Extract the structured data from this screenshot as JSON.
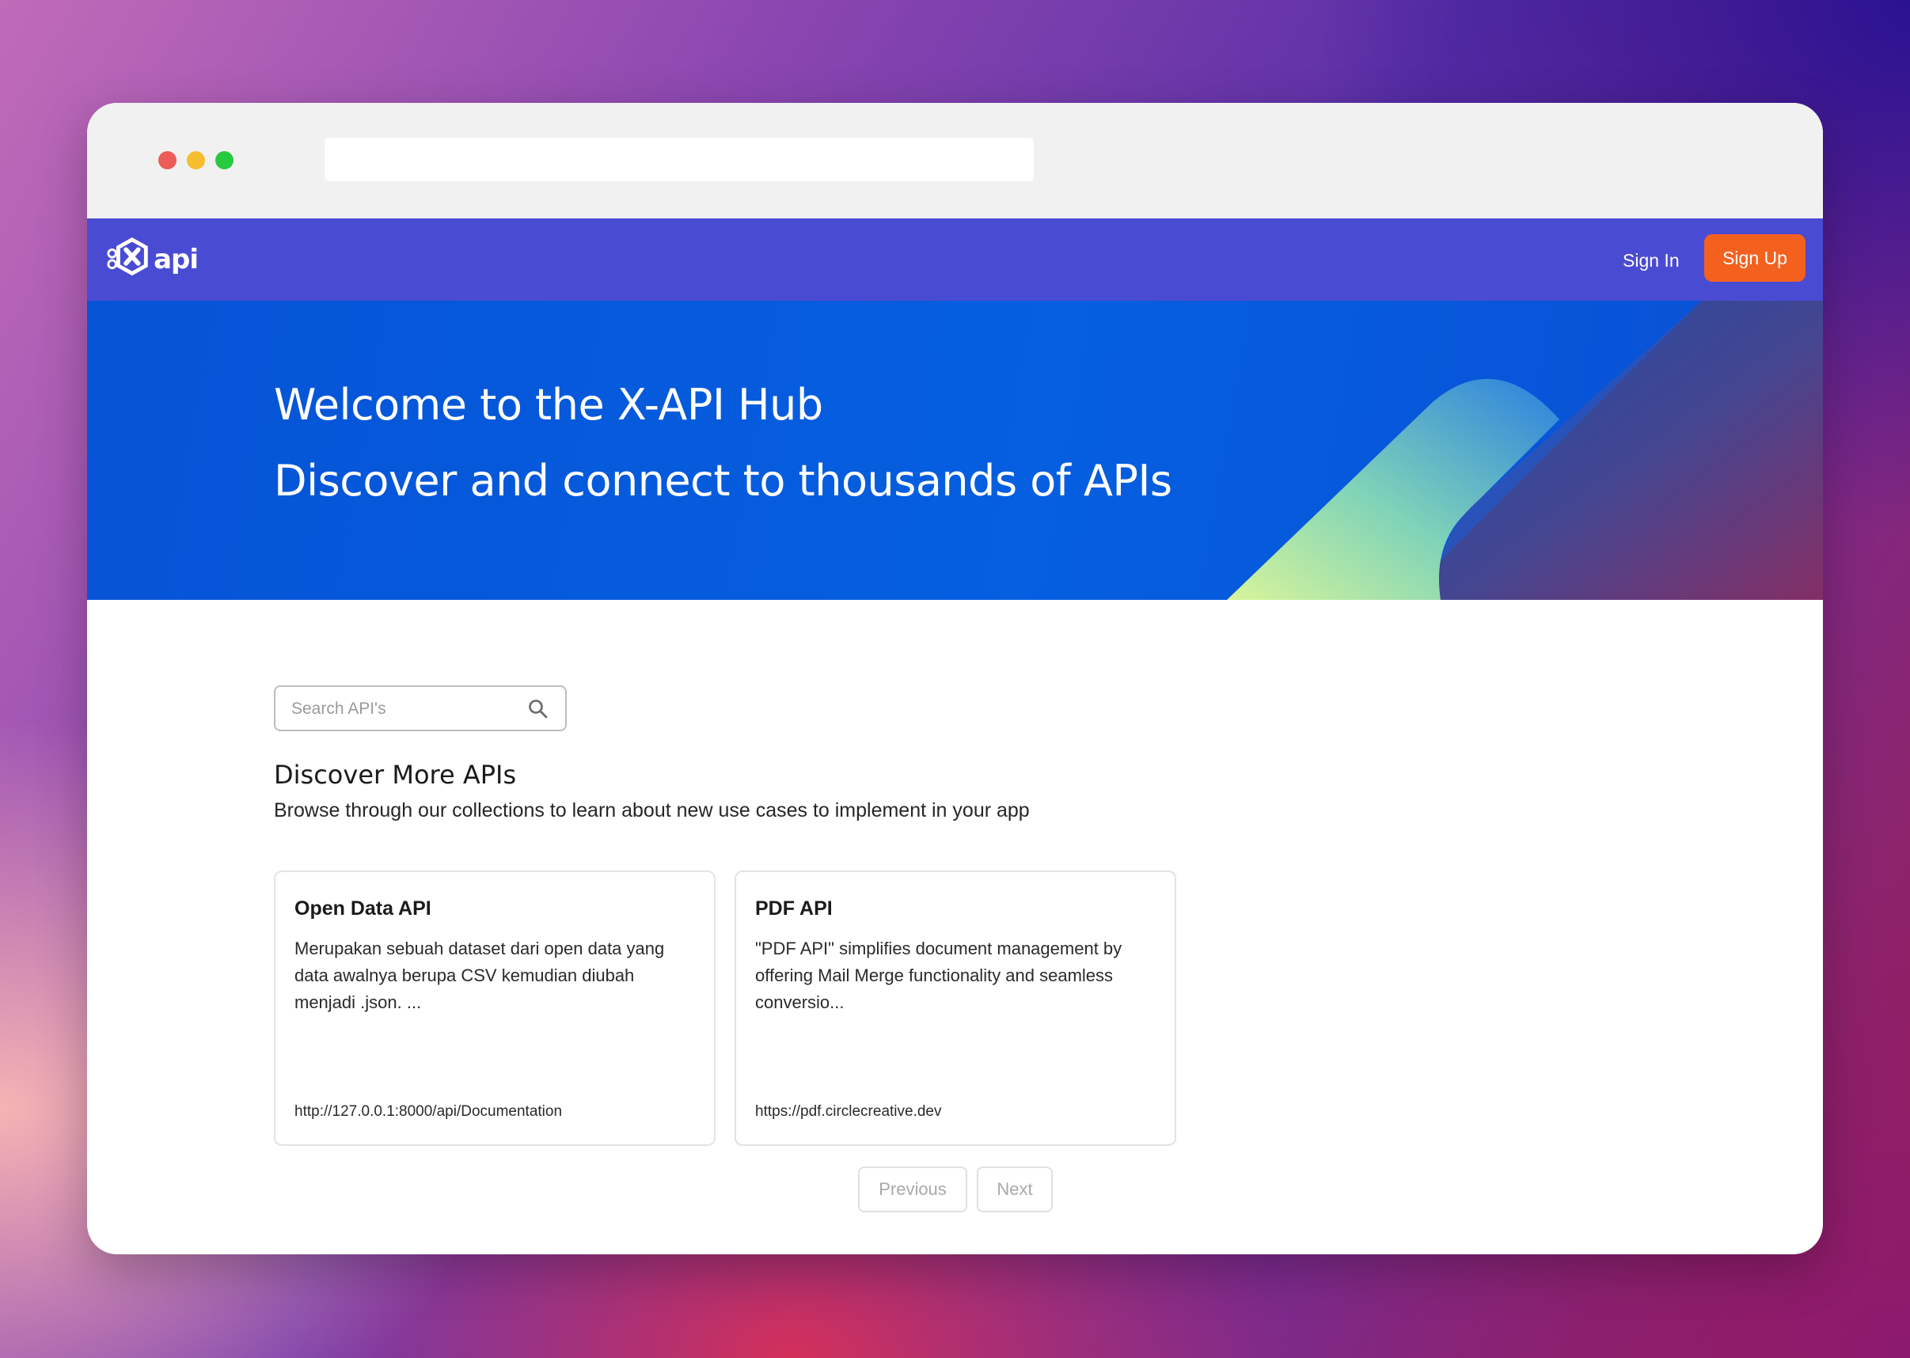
{
  "navbar": {
    "logo_text": "api",
    "sign_in_label": "Sign In",
    "sign_up_label": "Sign Up",
    "colors": {
      "navbar": "#4a4bd3",
      "sign_up": "#f4611e"
    }
  },
  "hero": {
    "title": "Welcome to the X-API Hub",
    "subtitle": "Discover and connect to thousands of APIs"
  },
  "search": {
    "placeholder": "Search API's",
    "value": "",
    "icon": "search-icon"
  },
  "discover": {
    "title": "Discover More APIs",
    "subtitle": "Browse through our collections to learn about new use cases to implement in your app"
  },
  "cards": [
    {
      "title": "Open Data API",
      "description": "Merupakan sebuah dataset dari open data yang data awalnya berupa CSV kemudian diubah menjadi .json. ...",
      "url": "http://127.0.0.1:8000/api/Documentation"
    },
    {
      "title": "PDF API",
      "description": "\"PDF API\" simplifies document management by offering Mail Merge functionality and seamless conversio...",
      "url": "https://pdf.circlecreative.dev"
    }
  ],
  "pagination": {
    "previous_label": "Previous",
    "next_label": "Next"
  }
}
